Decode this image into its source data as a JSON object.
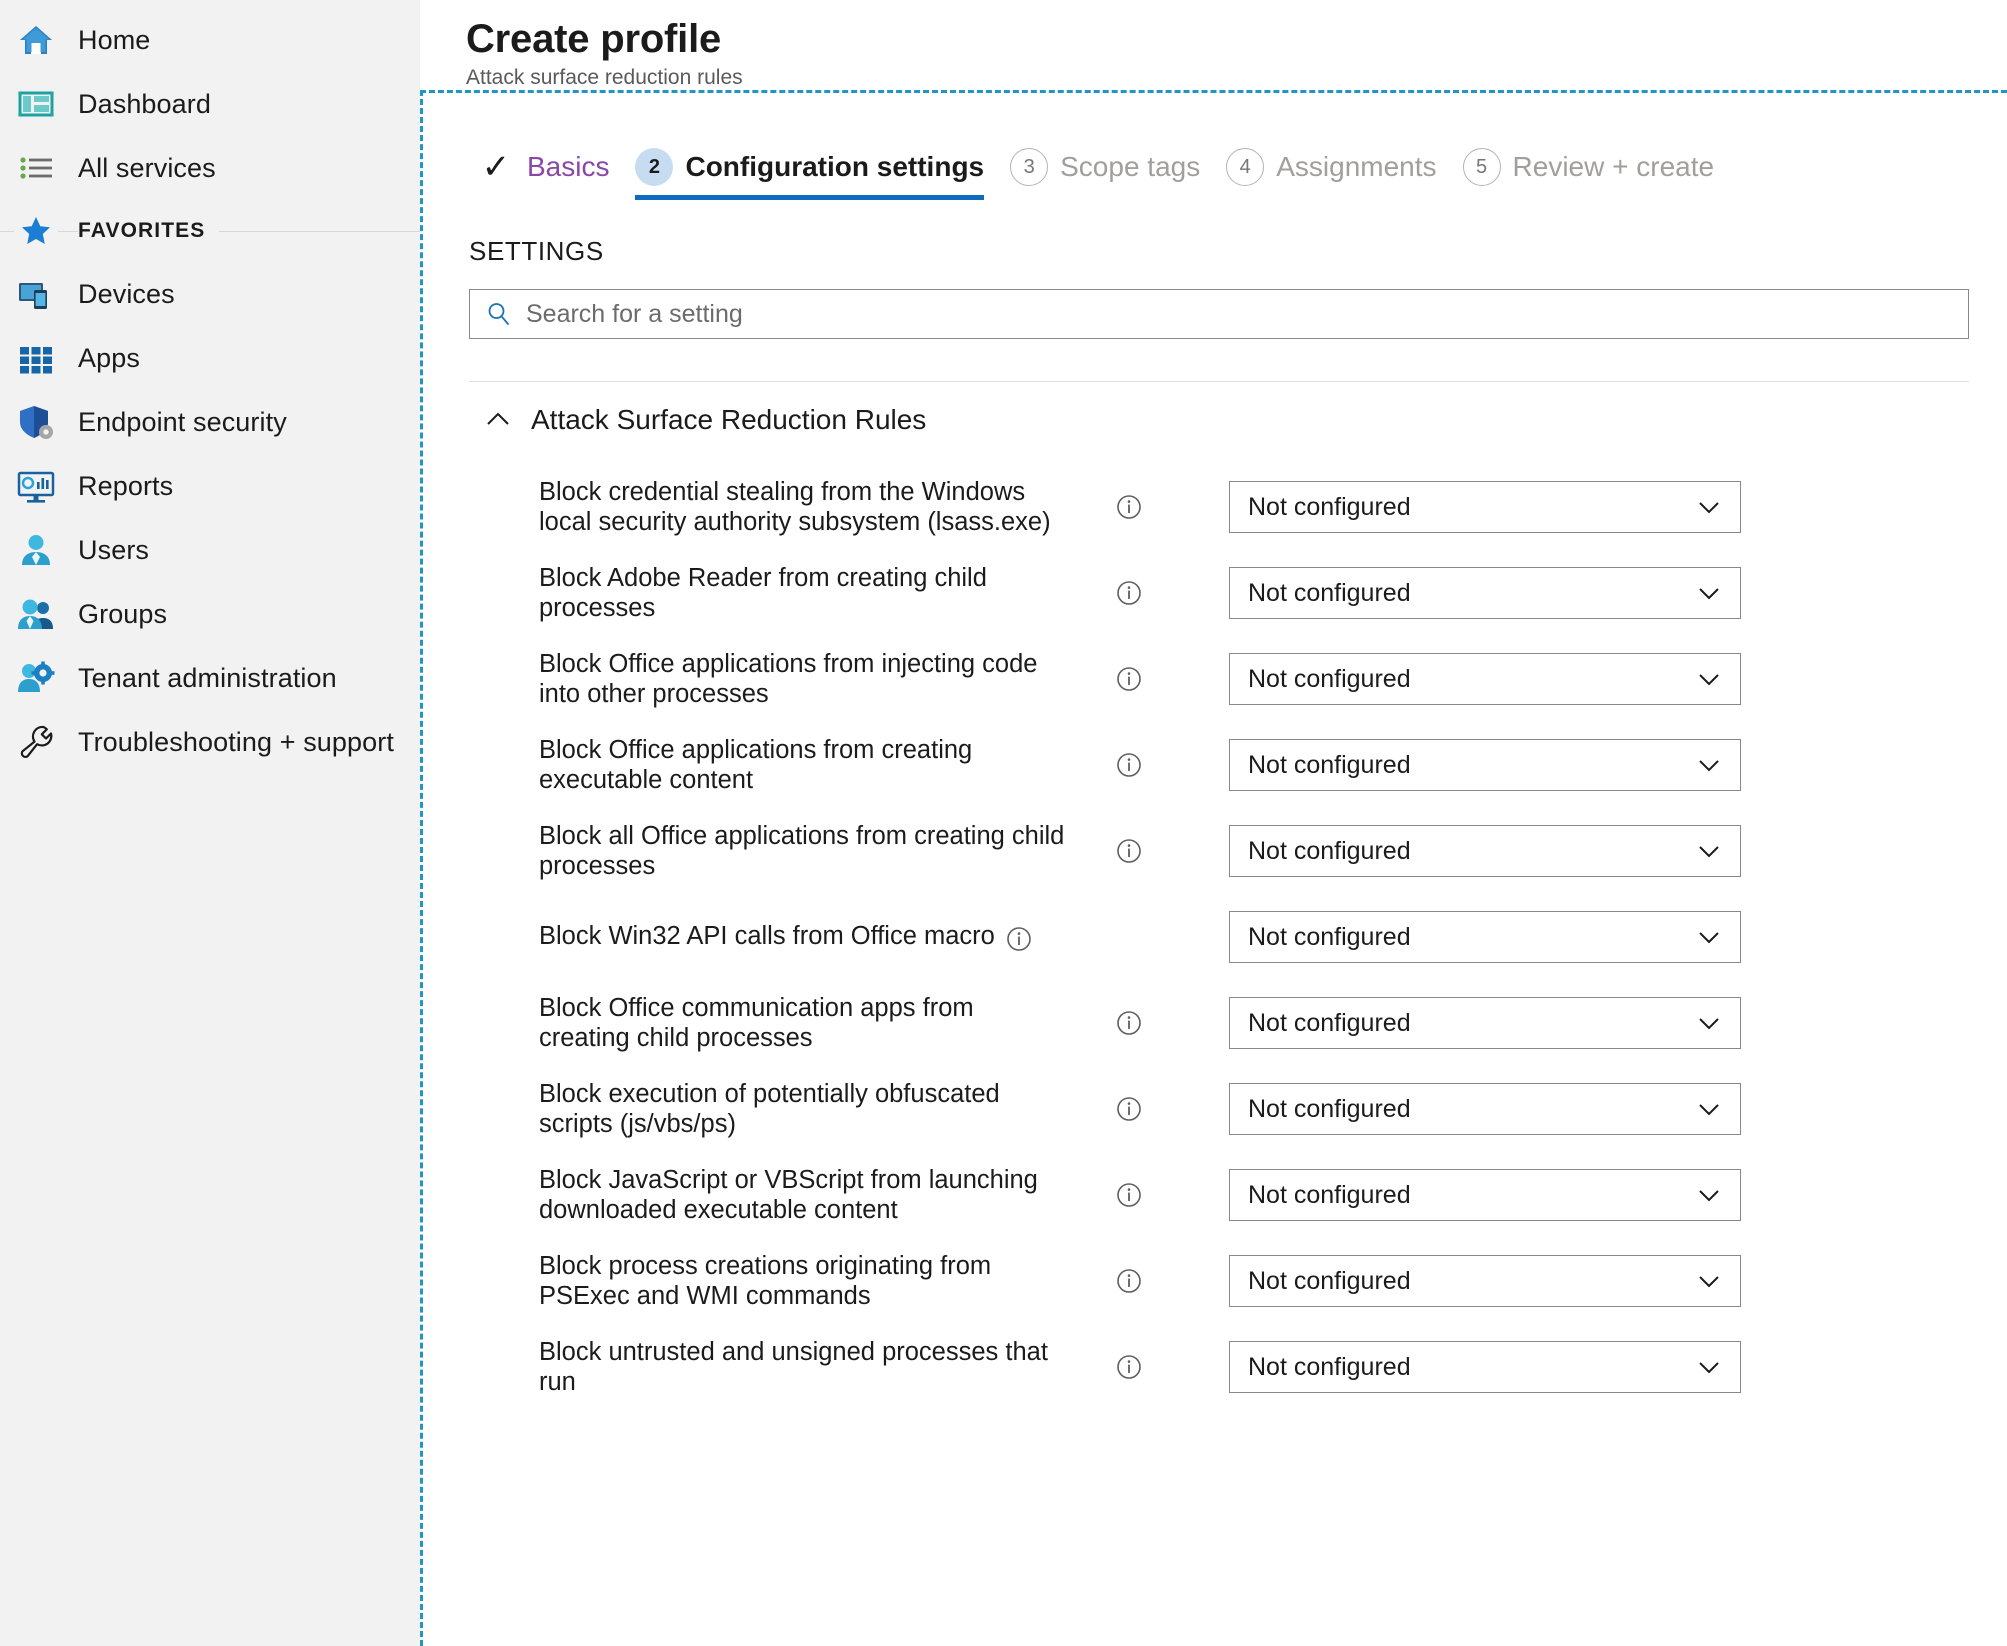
{
  "sidebar": {
    "items": [
      {
        "label": "Home",
        "icon": "home-icon"
      },
      {
        "label": "Dashboard",
        "icon": "dashboard-icon"
      },
      {
        "label": "All services",
        "icon": "all-services-icon"
      }
    ],
    "favorites_label": "FAVORITES",
    "favorites": [
      {
        "label": "Devices",
        "icon": "devices-icon"
      },
      {
        "label": "Apps",
        "icon": "apps-icon"
      },
      {
        "label": "Endpoint security",
        "icon": "shield-gear-icon"
      },
      {
        "label": "Reports",
        "icon": "reports-monitor-icon"
      },
      {
        "label": "Users",
        "icon": "user-icon"
      },
      {
        "label": "Groups",
        "icon": "groups-icon"
      },
      {
        "label": "Tenant administration",
        "icon": "tenant-admin-icon"
      },
      {
        "label": "Troubleshooting + support",
        "icon": "wrench-icon"
      }
    ]
  },
  "header": {
    "title": "Create profile",
    "subtitle": "Attack surface reduction rules"
  },
  "wizard": {
    "tabs": [
      {
        "marker": "✓",
        "label": "Basics",
        "state": "done"
      },
      {
        "marker": "2",
        "label": "Configuration settings",
        "state": "active"
      },
      {
        "marker": "3",
        "label": "Scope tags",
        "state": "upcoming"
      },
      {
        "marker": "4",
        "label": "Assignments",
        "state": "upcoming"
      },
      {
        "marker": "5",
        "label": "Review + create",
        "state": "upcoming"
      }
    ]
  },
  "settings": {
    "caption": "SETTINGS",
    "search_placeholder": "Search for a setting",
    "search_value": "",
    "group_title": "Attack Surface Reduction Rules",
    "group_expanded": true,
    "dropdown_value": "Not configured",
    "rules": [
      {
        "label": "Block credential stealing from the Windows local security authority subsystem (lsass.exe)",
        "value": "Not configured"
      },
      {
        "label": "Block Adobe Reader from creating child processes",
        "value": "Not configured"
      },
      {
        "label": "Block Office applications from injecting code into other processes",
        "value": "Not configured"
      },
      {
        "label": "Block Office applications from creating executable content",
        "value": "Not configured"
      },
      {
        "label": "Block all Office applications from creating child processes",
        "value": "Not configured"
      },
      {
        "label": "Block Win32 API calls from Office macro",
        "value": "Not configured"
      },
      {
        "label": "Block Office communication apps from creating child processes",
        "value": "Not configured"
      },
      {
        "label": "Block execution of potentially obfuscated scripts (js/vbs/ps)",
        "value": "Not configured"
      },
      {
        "label": "Block JavaScript or VBScript from launching downloaded executable content",
        "value": "Not configured"
      },
      {
        "label": "Block process creations originating from PSExec and WMI commands",
        "value": "Not configured"
      },
      {
        "label": "Block untrusted and unsigned processes that run",
        "value": "Not configured"
      }
    ]
  },
  "colors": {
    "accent_blue": "#0f6cbd",
    "dashed_border": "#2196c4",
    "done_tab": "#8a47a8",
    "sidebar_bg": "#f2f2f2"
  }
}
